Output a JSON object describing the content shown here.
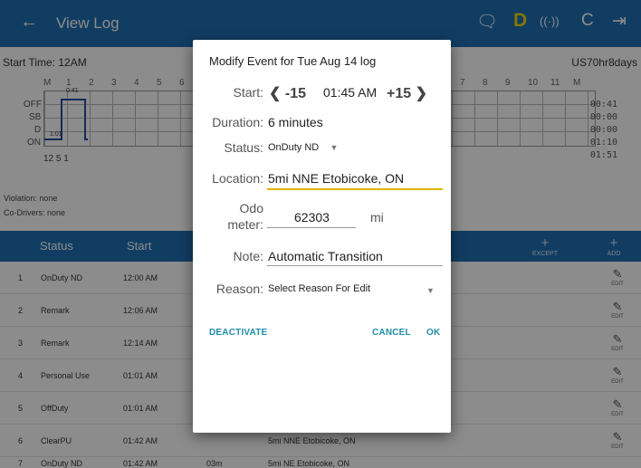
{
  "appbar": {
    "title": "View Log",
    "back_icon": "←",
    "message_icon": "🗨",
    "driver_badge": "D",
    "signal_icon": "((·))",
    "refresh_icon": "C",
    "logout_icon": "⇥"
  },
  "log": {
    "start_time": "Start Time: 12AM",
    "cycle": "US70hr8days",
    "status_labels": [
      "OFF",
      "SB",
      "D",
      "ON"
    ],
    "totals": [
      "00:41",
      "00:00",
      "00:00",
      "01:10",
      "01:51"
    ],
    "hours": [
      "M",
      "1",
      "2",
      "3",
      "4",
      "5",
      "6",
      "7",
      "8",
      "9",
      "10",
      "11",
      "M"
    ],
    "trace_note_1": "0:41",
    "trace_note_2": "1:01",
    "grid_footer": "12  5  1",
    "violation": "Violation: none",
    "co_drivers": "Co-Drivers: none"
  },
  "table": {
    "headers": {
      "status": "Status",
      "start": "Start"
    },
    "except_label": "EXCEPT",
    "add_label": "ADD",
    "plus": "+",
    "edit_label": "EDIT",
    "edit_icon": "✎",
    "rows": [
      {
        "num": "1",
        "status": "OnDuty ND",
        "start": "12:00 AM",
        "dur": "",
        "loc": ""
      },
      {
        "num": "2",
        "status": "Remark",
        "start": "12:06 AM",
        "dur": "",
        "loc": ""
      },
      {
        "num": "3",
        "status": "Remark",
        "start": "12:14 AM",
        "dur": "",
        "loc": ""
      },
      {
        "num": "4",
        "status": "Personal Use",
        "start": "01:01 AM",
        "dur": "",
        "loc": ""
      },
      {
        "num": "5",
        "status": "OffDuty",
        "start": "01:01 AM",
        "dur": "",
        "loc": ""
      },
      {
        "num": "6",
        "status": "ClearPU",
        "start": "01:42 AM",
        "dur": "",
        "loc": "5mi NNE Etobicoke, ON"
      },
      {
        "num": "7",
        "status": "OnDuty ND",
        "start": "01:42 AM",
        "dur": "03m",
        "loc": "5mi NE Etobicoke, ON"
      }
    ]
  },
  "dialog": {
    "title": "Modify Event for Tue Aug 14 log",
    "start_label": "Start:",
    "start_minus": "-15",
    "start_time": "01:45 AM",
    "start_plus": "+15",
    "left_arrow": "❮",
    "right_arrow": "❯",
    "duration_label": "Duration:",
    "duration_value": "6 minutes",
    "status_label": "Status:",
    "status_value": "OnDuty ND",
    "dropdown_icon": "▼",
    "location_label": "Location:",
    "location_value": "5mi NNE Etobicoke, ON",
    "odo_label_1": "Odo",
    "odo_label_2": "meter:",
    "odo_value": "62303",
    "odo_unit": "mi",
    "note_label": "Note:",
    "note_value": "Automatic Transition",
    "reason_label": "Reason:",
    "reason_value": "Select Reason For Edit",
    "deactivate": "DEACTIVATE",
    "cancel": "CANCEL",
    "ok": "OK"
  }
}
